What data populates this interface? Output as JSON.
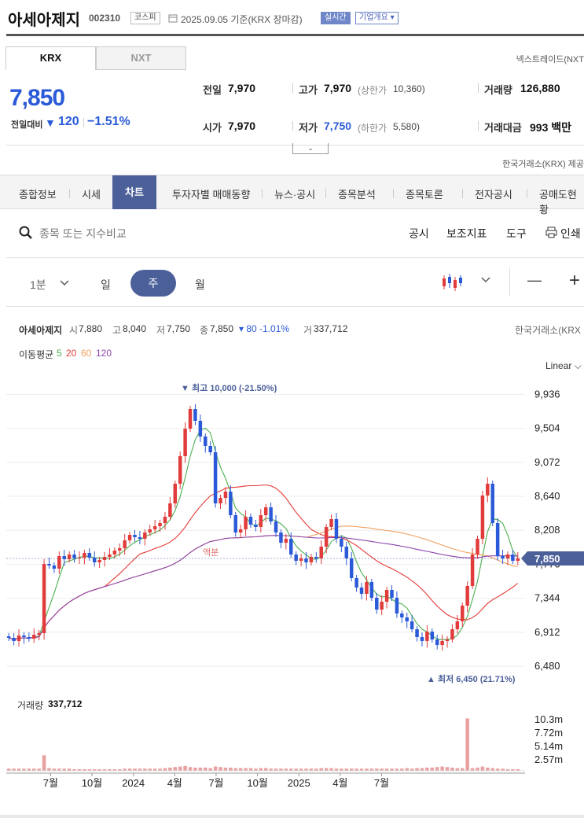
{
  "header": {
    "company": "아세아제지",
    "code": "002310",
    "market_badge": "코스피",
    "date_text": "2025.09.05 기준(KRX 장마감)",
    "realtime_badge": "실시간",
    "overview_badge": "기업개요 ▾"
  },
  "market_tabs": [
    "KRX",
    "NXT"
  ],
  "nextrade_note": "넥스트레이드(NXT",
  "quote": {
    "price": "7,850",
    "change_label": "전일대비",
    "change_arrow": "▼",
    "change": "120",
    "change_pct": "−1.51%",
    "prev_label": "전일",
    "prev": "7,970",
    "open_label": "시가",
    "open": "7,970",
    "high_label": "고가",
    "high": "7,970",
    "upper_label": "(상한가",
    "upper": "10,360)",
    "low_label": "저가",
    "low": "7,750",
    "lower_label": "(하한가",
    "lower": "5,580)",
    "volume_label": "거래량",
    "volume": "126,880",
    "amount_label": "거래대금",
    "amount": "993 백만",
    "source": "한국거래소(KRX) 제공"
  },
  "nav": [
    "종합정보",
    "시세",
    "차트",
    "투자자별 매매동향",
    "뉴스·공시",
    "종목분석",
    "종목토론",
    "전자공시",
    "공매도현황"
  ],
  "toolbar": {
    "search_placeholder": "종목 또는 지수비교",
    "items": [
      "공시",
      "보조지표",
      "도구",
      "인쇄"
    ],
    "periods": [
      "1분",
      "일",
      "주",
      "월"
    ],
    "zoom_out": "—",
    "zoom_in": "+"
  },
  "chart_info": {
    "name": "아세아제지",
    "open_label": "시",
    "open": "7,880",
    "high_label": "고",
    "high": "8,040",
    "low_label": "저",
    "low": "7,750",
    "close_label": "종",
    "close": "7,850",
    "change": "▾ 80 -1.01%",
    "vol_label": "거",
    "vol": "337,712",
    "source": "한국거래소(KRX",
    "ma_label": "이동평균",
    "ma_periods": [
      "5",
      "20",
      "60",
      "120"
    ],
    "scale": "Linear ⌵"
  },
  "chart_data": {
    "type": "candlestick",
    "interval": "weekly",
    "y_ticks": [
      9936,
      9504,
      9072,
      8640,
      8208,
      7776,
      7344,
      6912,
      6480
    ],
    "y_tick_labels": [
      "9,936",
      "9,504",
      "9,072",
      "8,640",
      "8,208",
      "7,776",
      "7,344",
      "6,912",
      "6,480"
    ],
    "ylim": [
      6250,
      10150
    ],
    "x_labels": [
      "7월",
      "10월",
      "2024",
      "4월",
      "7월",
      "10월",
      "2025",
      "4월",
      "7월"
    ],
    "current_price": 7850,
    "current_price_label": "7,850",
    "high_marker": "▼ 최고 10,000 (-21.50%)",
    "low_marker": "▲ 최저 6,450 (21.71%)",
    "annotation": "액분",
    "closes": [
      6840,
      6800,
      6870,
      6850,
      6830,
      6880,
      6900,
      7780,
      7760,
      7720,
      7880,
      7840,
      7900,
      7850,
      7860,
      7920,
      7860,
      7800,
      7830,
      7870,
      7900,
      7950,
      7980,
      8080,
      8150,
      8120,
      8100,
      8180,
      8220,
      8260,
      8300,
      8380,
      8550,
      8800,
      9150,
      9500,
      9750,
      9600,
      9400,
      9280,
      9200,
      8550,
      8620,
      8700,
      8400,
      8180,
      8220,
      8380,
      8280,
      8250,
      8400,
      8500,
      8320,
      8180,
      8050,
      8100,
      7900,
      7820,
      7850,
      7800,
      7870,
      7850,
      8000,
      8250,
      8350,
      8100,
      8000,
      7850,
      7600,
      7480,
      7400,
      7550,
      7350,
      7200,
      7300,
      7450,
      7350,
      7150,
      7100,
      7050,
      6950,
      6850,
      6800,
      6920,
      6820,
      6750,
      6800,
      6820,
      6950,
      7050,
      7250,
      7500,
      7900,
      8100,
      8650,
      8800,
      8300,
      7880,
      7850,
      7900,
      7820,
      7850
    ],
    "ma5_color": "#4caf50",
    "ma20_color": "#e53935",
    "ma60_color": "#f0a060",
    "ma120_color": "#8e44ad",
    "volume_label": "거래량",
    "volume": "337,712",
    "volume_ticks": [
      "10.3m",
      "7.72m",
      "5.14m",
      "2.57m"
    ],
    "volume_max": 10300000,
    "volumes": [
      0.4,
      0.4,
      0.4,
      0.4,
      0.4,
      0.4,
      0.4,
      2.9,
      0.5,
      0.4,
      0.4,
      0.4,
      0.4,
      0.3,
      0.3,
      0.3,
      0.3,
      0.3,
      0.3,
      0.3,
      0.3,
      0.3,
      0.3,
      0.4,
      0.4,
      0.4,
      0.4,
      0.4,
      0.4,
      0.4,
      0.4,
      0.5,
      0.6,
      0.7,
      0.8,
      0.9,
      0.7,
      0.6,
      0.6,
      0.6,
      0.5,
      0.8,
      0.7,
      0.6,
      0.6,
      0.5,
      0.5,
      0.5,
      0.5,
      0.4,
      0.5,
      0.5,
      0.4,
      0.4,
      0.4,
      0.4,
      0.4,
      0.4,
      0.4,
      0.4,
      0.4,
      0.4,
      0.5,
      0.5,
      0.5,
      0.4,
      0.4,
      0.4,
      0.4,
      0.4,
      0.4,
      0.4,
      0.4,
      0.4,
      0.4,
      0.4,
      0.4,
      0.4,
      0.4,
      0.5,
      0.4,
      0.5,
      0.5,
      0.6,
      0.6,
      0.7,
      0.8,
      0.7,
      0.6,
      0.5,
      0.5,
      9.8,
      0.5,
      0.6,
      0.8,
      0.6,
      0.5,
      0.4,
      0.4,
      0.3,
      0.3,
      0.3
    ]
  }
}
